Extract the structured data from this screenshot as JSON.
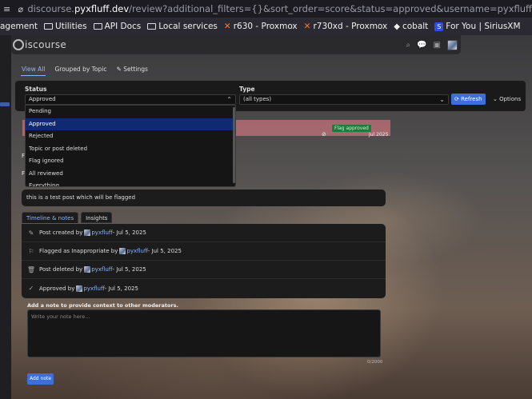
{
  "browser": {
    "url_prefix": "discourse.",
    "url_domain": "pyxfluff.dev",
    "url_path": "/review?additional_filters={}&sort_order=score&status=approved&username=pyxfluff"
  },
  "bookmarks": [
    {
      "label": "agement",
      "icon": "none"
    },
    {
      "label": "Utilities",
      "icon": "folder-icon"
    },
    {
      "label": "API Docs",
      "icon": "folder-icon"
    },
    {
      "label": "Local services",
      "icon": "folder-icon"
    },
    {
      "label": "r630 - Proxmox",
      "icon": "proxmox-icon"
    },
    {
      "label": "r730xd - Proxmox",
      "icon": "proxmox-icon"
    },
    {
      "label": "cobalt",
      "icon": "diamond-icon"
    },
    {
      "label": "For You | SiriusXM",
      "icon": "siriusxm-icon"
    }
  ],
  "header": {
    "logo_text": "iscourse"
  },
  "tabs": [
    {
      "label": "View All",
      "active": true
    },
    {
      "label": "Grouped by Topic",
      "active": false
    },
    {
      "label": "Settings",
      "active": false
    }
  ],
  "filters": {
    "status_label": "Status",
    "status_value": "Approved",
    "type_label": "Type",
    "type_value": "(all types)",
    "refresh_label": "Refresh",
    "options_label": "Options"
  },
  "status_options": [
    "Pending",
    "Approved",
    "Rejected",
    "Topic or post deleted",
    "Flag ignored",
    "All reviewed",
    "Everything"
  ],
  "status_selected_index": 1,
  "review": {
    "badge": "Flag approved",
    "date": "Jul 2025",
    "side_letters": [
      "F",
      "F"
    ],
    "post_text": "this is a test post which will be flagged"
  },
  "timeline_tabs": [
    {
      "label": "Timeline & notes",
      "active": true
    },
    {
      "label": "Insights",
      "active": false
    }
  ],
  "timeline": [
    {
      "icon": "pencil-icon",
      "glyph": "✎",
      "action": "Post created by",
      "user": "pyxfluff",
      "date": " - Jul 5, 2025"
    },
    {
      "icon": "flag-icon",
      "glyph": "⚐",
      "action": "Flagged as Inappropriate by",
      "user": "pyxfluff",
      "date": " - Jul 5, 2025"
    },
    {
      "icon": "trash-icon",
      "glyph": "🗑",
      "action": "Post deleted by",
      "user": "pyxfluff",
      "date": " - Jul 5, 2025"
    },
    {
      "icon": "check-icon",
      "glyph": "✓",
      "action": "Approved by",
      "user": "pyxfluff",
      "date": " - Jul 5, 2025"
    }
  ],
  "note": {
    "label": "Add a note to provide context to other moderators.",
    "placeholder": "Write your note here...",
    "counter": "0/2000",
    "button": "Add note"
  }
}
